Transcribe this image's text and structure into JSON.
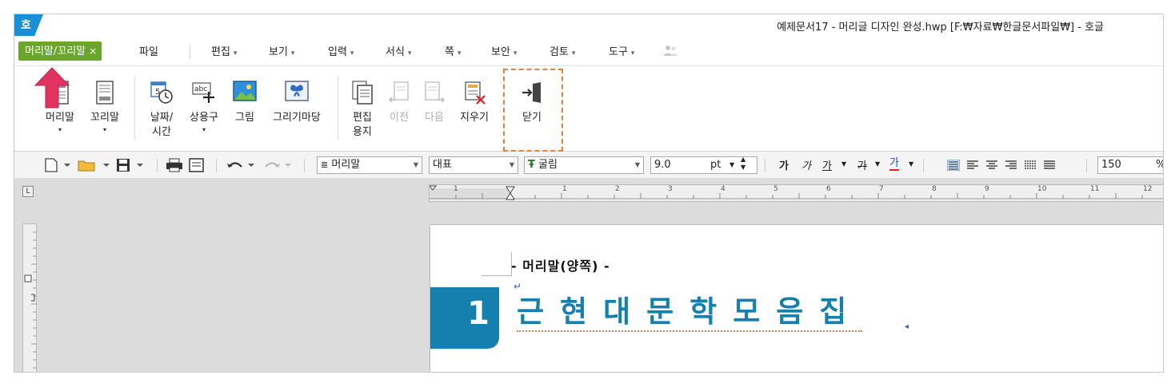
{
  "app": {
    "logo_text": "호",
    "window_title": "예제문서17 - 머리글 디자인 완성.hwp [F:₩자료₩한글문서파일₩] - 호글"
  },
  "menubar": {
    "context_tab": "머리말/꼬리말",
    "context_tab_close": "×",
    "file": "파일",
    "items": [
      {
        "label": "편집",
        "arrow": "▾"
      },
      {
        "label": "보기",
        "arrow": "▾"
      },
      {
        "label": "입력",
        "arrow": "▾"
      },
      {
        "label": "서식",
        "arrow": "▾"
      },
      {
        "label": "쪽",
        "arrow": "▾"
      },
      {
        "label": "보안",
        "arrow": "▾"
      },
      {
        "label": "검토",
        "arrow": "▾"
      },
      {
        "label": "도구",
        "arrow": "▾"
      }
    ]
  },
  "ribbon": {
    "header": {
      "label": "머리말",
      "dropdown": "▾"
    },
    "footer": {
      "label": "꼬리말",
      "dropdown": "▾"
    },
    "datetime": {
      "line1": "날짜/",
      "line2": "시간"
    },
    "phrases": {
      "label": "상용구",
      "dropdown": "▾"
    },
    "picture": {
      "label": "그림"
    },
    "drawing": {
      "label": "그리기마당"
    },
    "edit_paper": {
      "line1": "편집",
      "line2": "용지"
    },
    "prev": {
      "label": "이전"
    },
    "next": {
      "label": "다음"
    },
    "erase": {
      "label": "지우기"
    },
    "close": {
      "label": "닫기"
    },
    "datetime_icon_number": "5",
    "phrases_icon_text": "abc"
  },
  "toolbar": {
    "style": "머리말",
    "language": "대표",
    "font": "굴림",
    "font_icon": "Ŧ",
    "font_size": "9.0",
    "font_unit": "pt",
    "bold": "가",
    "italic": "가",
    "underline": "가",
    "strike": "가",
    "color": "가",
    "zoom": "150",
    "zoom_unit": "%"
  },
  "ruler": {
    "corner": "L",
    "ticks": [
      "1",
      "1",
      "2",
      "3",
      "4",
      "5",
      "6",
      "7",
      "8",
      "9",
      "10",
      "11",
      "12"
    ]
  },
  "document": {
    "header_label": "- 머리말(양쪽) -",
    "chapter_number": "1",
    "title": "근현대문학모음집"
  }
}
